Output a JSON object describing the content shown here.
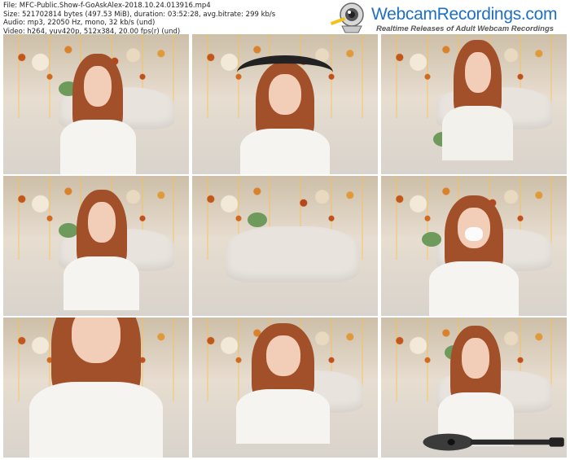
{
  "file_info": {
    "file_line": "File: MFC-Public.Show-f-GoAskAlex-2018.10.24.013916.mp4",
    "size_line": "Size: 521702814 bytes (497.53 MiB), duration: 03:52:28, avg.bitrate: 299 kb/s",
    "audio_line": "Audio: mp3, 22050 Hz, mono, 32 kb/s (und)",
    "video_line": "Video: h264, yuv420p, 512x384, 20.00 fps(r) (und)"
  },
  "brand": {
    "title": "WebcamRecordings.com",
    "subtitle": "Realtime Releases of Adult Webcam Recordings",
    "color": "#1f6fc4",
    "icon": "webcam-icon"
  },
  "thumbnails": [
    {
      "variant": "plain"
    },
    {
      "variant": "horns"
    },
    {
      "variant": "plain"
    },
    {
      "variant": "plain"
    },
    {
      "variant": "empty"
    },
    {
      "variant": "nose"
    },
    {
      "variant": "closeup"
    },
    {
      "variant": "plain"
    },
    {
      "variant": "ukulele"
    }
  ]
}
